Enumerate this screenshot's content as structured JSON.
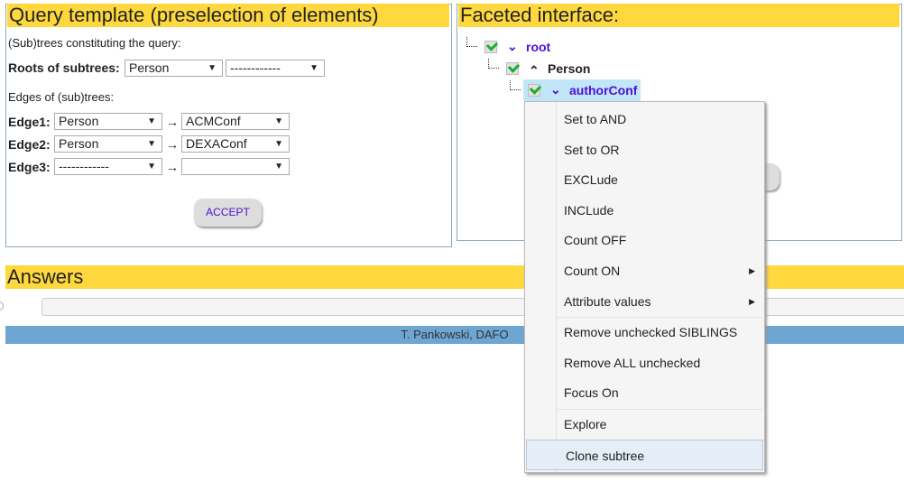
{
  "query": {
    "title": "Query template (preselection of elements)",
    "subtrees_label": "(Sub)trees constituting the query:",
    "roots_label": "Roots of subtrees:",
    "roots": [
      "Person",
      "------------"
    ],
    "edges_label": "Edges of (sub)trees:",
    "edges": [
      {
        "label": "Edge1:",
        "from": "Person",
        "to": "ACMConf"
      },
      {
        "label": "Edge2:",
        "from": "Person",
        "to": "DEXAConf"
      },
      {
        "label": "Edge3:",
        "from": "------------",
        "to": ""
      }
    ],
    "arrow": "→",
    "accept": "ACCEPT"
  },
  "faceted": {
    "title": "Faceted interface:",
    "nodes": [
      {
        "label": "root",
        "chevron": "chevron-down",
        "checked": true
      },
      {
        "label": "Person",
        "chevron": "chevron-up",
        "checked": true
      },
      {
        "label": "authorConf",
        "chevron": "chevron-down",
        "checked": true,
        "selected": true
      }
    ]
  },
  "answers": {
    "title": "Answers",
    "footer": "T. Pankowski, DAFO"
  },
  "menu": {
    "items": [
      "Set to AND",
      "Set to OR",
      "EXCLude",
      "INCLude",
      "Count OFF",
      "Count ON",
      "Attribute values",
      "Remove unchecked SIBLINGS",
      "Remove ALL unchecked",
      "Focus On",
      "Explore",
      "Clone subtree"
    ]
  },
  "colors": {
    "header": "#fed83d",
    "link": "#4b0fd6",
    "footer": "#6ea6d3",
    "selected": "#c2e6f9"
  }
}
